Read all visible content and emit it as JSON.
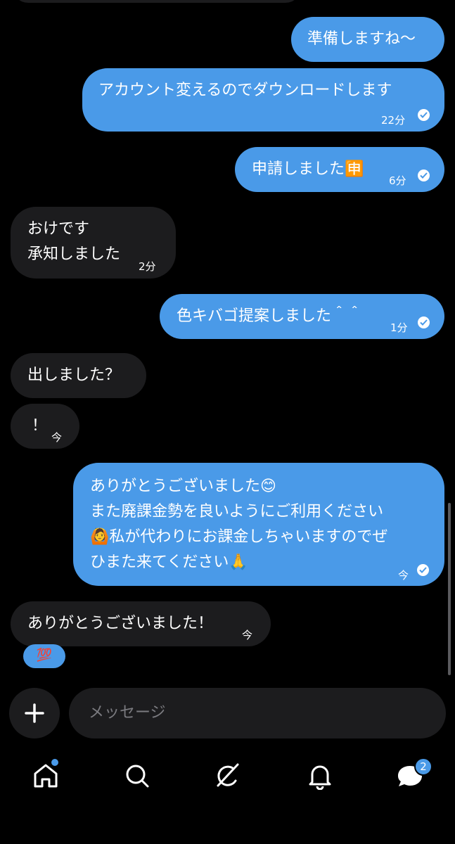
{
  "messages": [
    {
      "text": "準備しますね〜"
    },
    {
      "text": "アカウント変えるのでダウンロードします",
      "time": "22分"
    },
    {
      "text": "申請しました🈸",
      "time": "6分"
    },
    {
      "line1": "おけです",
      "line2": "承知しました",
      "time": "2分"
    },
    {
      "text": "色キバゴ提案しました＾＾",
      "time": "1分"
    },
    {
      "text": "出しました？"
    },
    {
      "text": "！",
      "time": "今"
    },
    {
      "line1": "ありがとうございました😊",
      "line2": "また廃課金勢を良いようにご利用ください",
      "line3": "🙆私が代わりにお課金しちゃいますのでぜ",
      "line4": "ひまた来てください🙏",
      "time": "今"
    },
    {
      "text": "ありがとうございました！",
      "time": "今",
      "reaction": "💯"
    }
  ],
  "composer": {
    "placeholder": "メッセージ"
  },
  "nav": {
    "messages_badge": "2"
  },
  "colors": {
    "outgoing_bubble": "#4a9ae8",
    "incoming_bubble": "#1c1c1e",
    "background": "#000000",
    "badge": "#4a9ae8"
  },
  "icons": [
    "plus-icon",
    "home-icon",
    "search-icon",
    "grok-icon",
    "bell-icon",
    "messages-icon",
    "read-check-icon"
  ]
}
